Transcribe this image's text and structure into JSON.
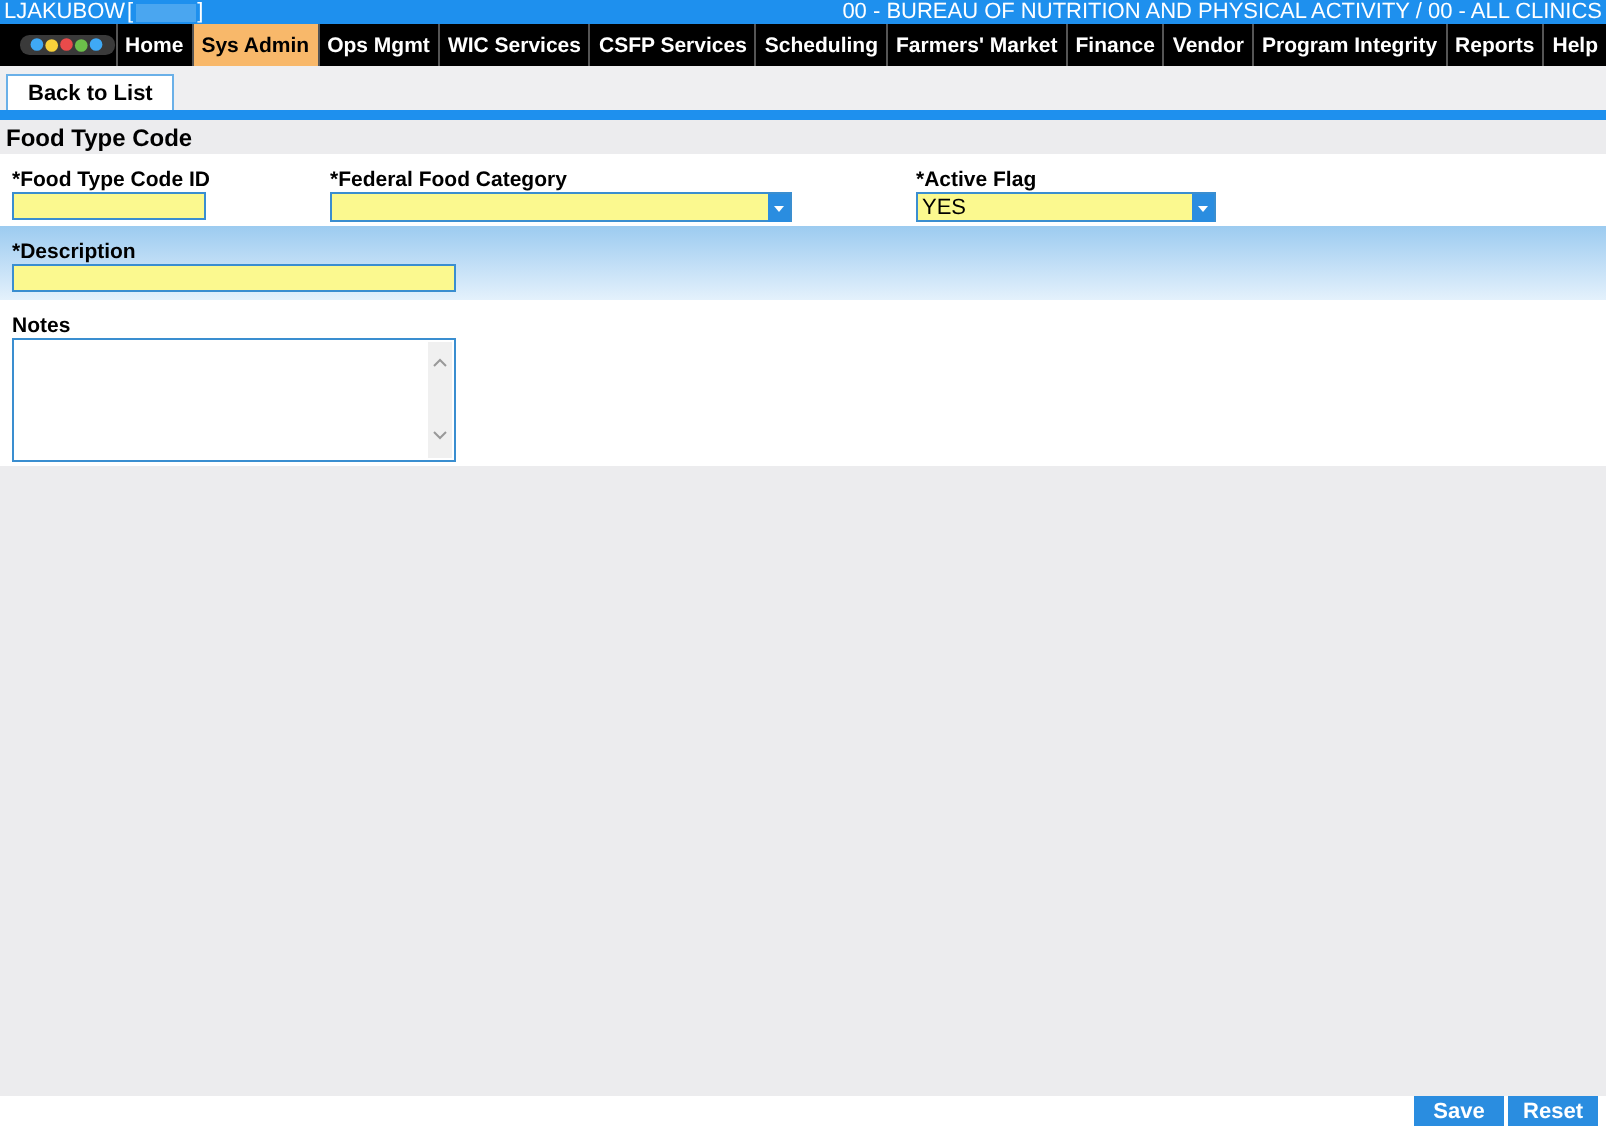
{
  "header": {
    "user": "LJAKUBOW",
    "bracket_open": "[",
    "bracket_close": "]",
    "agency": "00 - BUREAU OF NUTRITION AND PHYSICAL ACTIVITY / 00 - ALL CLINICS"
  },
  "nav": [
    {
      "label": "Home",
      "selected": false
    },
    {
      "label": "Sys Admin",
      "selected": true
    },
    {
      "label": "Ops Mgmt",
      "selected": false
    },
    {
      "label": "WIC Services",
      "selected": false
    },
    {
      "label": "CSFP Services",
      "selected": false
    },
    {
      "label": "Scheduling",
      "selected": false
    },
    {
      "label": "Farmers' Market",
      "selected": false
    },
    {
      "label": "Finance",
      "selected": false
    },
    {
      "label": "Vendor",
      "selected": false
    },
    {
      "label": "Program Integrity",
      "selected": false
    },
    {
      "label": "Reports",
      "selected": false
    },
    {
      "label": "Help",
      "selected": false
    }
  ],
  "back_tab": "Back to List",
  "section_title": "Food Type Code",
  "rows": [
    {
      "shaded": false,
      "fields": [
        {
          "kind": "text",
          "label": "*Food Type Code ID"
        },
        {
          "kind": "select",
          "label": "*Federal Food Category"
        },
        {
          "kind": "select",
          "label": "*Active Flag",
          "value": "YES"
        }
      ]
    },
    {
      "shaded": true,
      "fields": [
        {
          "kind": "text",
          "label": "*Description"
        }
      ]
    },
    {
      "shaded": false,
      "fields": [
        {
          "kind": "textarea",
          "label": "Notes"
        }
      ]
    }
  ],
  "buttons": [
    "Save",
    "Reset"
  ]
}
